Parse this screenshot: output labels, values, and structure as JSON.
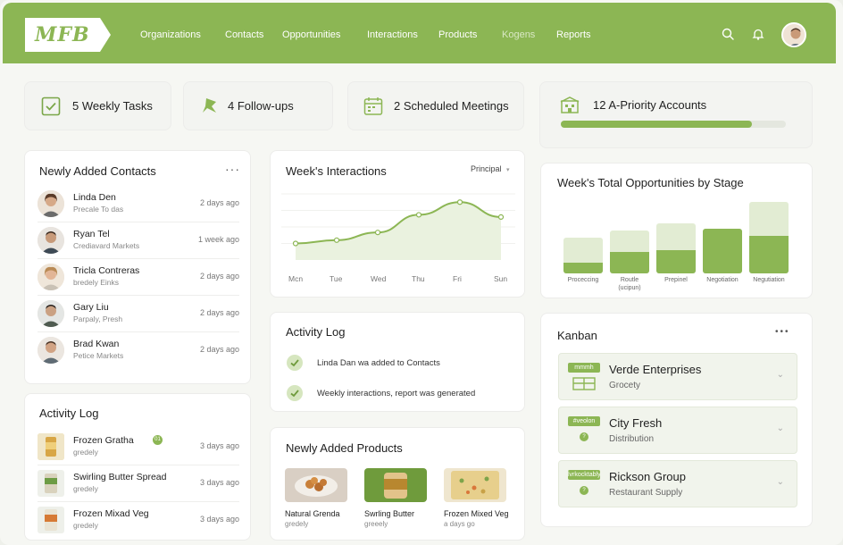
{
  "app": {
    "logo_text": "MFB"
  },
  "nav": {
    "items": [
      "Organizations",
      "Contacts",
      "Opportunities",
      "Interactions",
      "Products",
      "Kogens",
      "Reports"
    ]
  },
  "stats": {
    "tasks": "5 Weekly Tasks",
    "followups": "4 Follow-ups",
    "meetings": "2 Scheduled Meetings",
    "accounts": "12 A-Priority Accounts",
    "accounts_progress": 0.85
  },
  "contacts": {
    "title": "Newly Added Contacts",
    "more": "···",
    "rows": [
      {
        "name": "Linda Den",
        "sub": "Precale To das",
        "time": "2 days ago"
      },
      {
        "name": "Ryan Tel",
        "sub": "Crediavard Markets",
        "time": "1 week ago"
      },
      {
        "name": "Tricla Contreras",
        "sub": "bredely Einks",
        "time": "2 days ago"
      },
      {
        "name": "Gary Liu",
        "sub": "Parpaly, Presh",
        "time": "2 days ago"
      },
      {
        "name": "Brad Kwan",
        "sub": "Petice Markets",
        "time": "2 days ago"
      }
    ]
  },
  "activity_left": {
    "title": "Activity Log",
    "rows": [
      {
        "name": "Frozen Gratha",
        "badge": "01",
        "sub": "gredely",
        "time": "3 days ago"
      },
      {
        "name": "Swirling Butter Spread",
        "sub": "gredely",
        "time": "3 days ago"
      },
      {
        "name": "Frozen Mixad Veg",
        "sub": "gredely",
        "time": "3 days ago"
      }
    ]
  },
  "interactions": {
    "title": "Week's Interactions",
    "filter": "Principal",
    "filter_caret": "▾"
  },
  "chart_data": {
    "type": "line",
    "title": "Week's Interactions",
    "categories": [
      "Mon",
      "Tue",
      "Wed",
      "Thu",
      "Fri",
      "Sun"
    ],
    "x_tick_labels": [
      "Mcn",
      "Tue",
      "Wed",
      "Thu",
      "Fri",
      "Sun"
    ],
    "series": [
      {
        "values": [
          3,
          3.6,
          5,
          8.2,
          10.5,
          7.8
        ]
      }
    ],
    "xlabel": "",
    "ylabel": "",
    "grid": true
  },
  "opps_chart": {
    "type": "bar",
    "title": "Week's Total Opportunities by Stage",
    "categories": [
      "Proceccing",
      "Routle (uclpun)",
      "Prepinel",
      "Negotiation",
      "Negotiation"
    ],
    "labels": [
      "Proceccing",
      "Routle",
      "Prepinel",
      "Negotiation",
      "Negutiation"
    ],
    "sub_labels": [
      "",
      "(ucipun)",
      "",
      "",
      ""
    ],
    "totals": [
      40,
      48,
      56,
      50,
      80
    ],
    "filled": [
      12,
      24,
      26,
      50,
      42
    ]
  },
  "activity_mid": {
    "title": "Activity Log",
    "rows": [
      "Linda Dan wa added to Contacts",
      "Weekly interactions, report was generated"
    ]
  },
  "products": {
    "title": "Newly Added Products",
    "items": [
      {
        "name": "Natural Grenda",
        "sub": "gredely"
      },
      {
        "name": "Swrling Butter",
        "sub": "greeely"
      },
      {
        "name": "Frozen Mixed Veg",
        "sub": "a days go"
      }
    ]
  },
  "kanban": {
    "title": "Kanban",
    "more": "•••",
    "items": [
      {
        "tag": "mmmh",
        "name": "Verde Enterprises",
        "sub": "Grocety"
      },
      {
        "tag": "#veolon",
        "name": "City Fresh",
        "sub": "Distribution"
      },
      {
        "tag": "lvrkocktably",
        "name": "Rickson Group",
        "sub": "Restaurant Supply"
      }
    ]
  },
  "colors": {
    "accent": "#8cb654",
    "accent_light": "#e2ecd3",
    "background": "#f6f7f3"
  },
  "icons": [
    "search-icon",
    "bell-icon",
    "checkbox-icon",
    "pin-icon",
    "calendar-icon",
    "building-icon",
    "check-icon",
    "chevron-down-icon"
  ]
}
